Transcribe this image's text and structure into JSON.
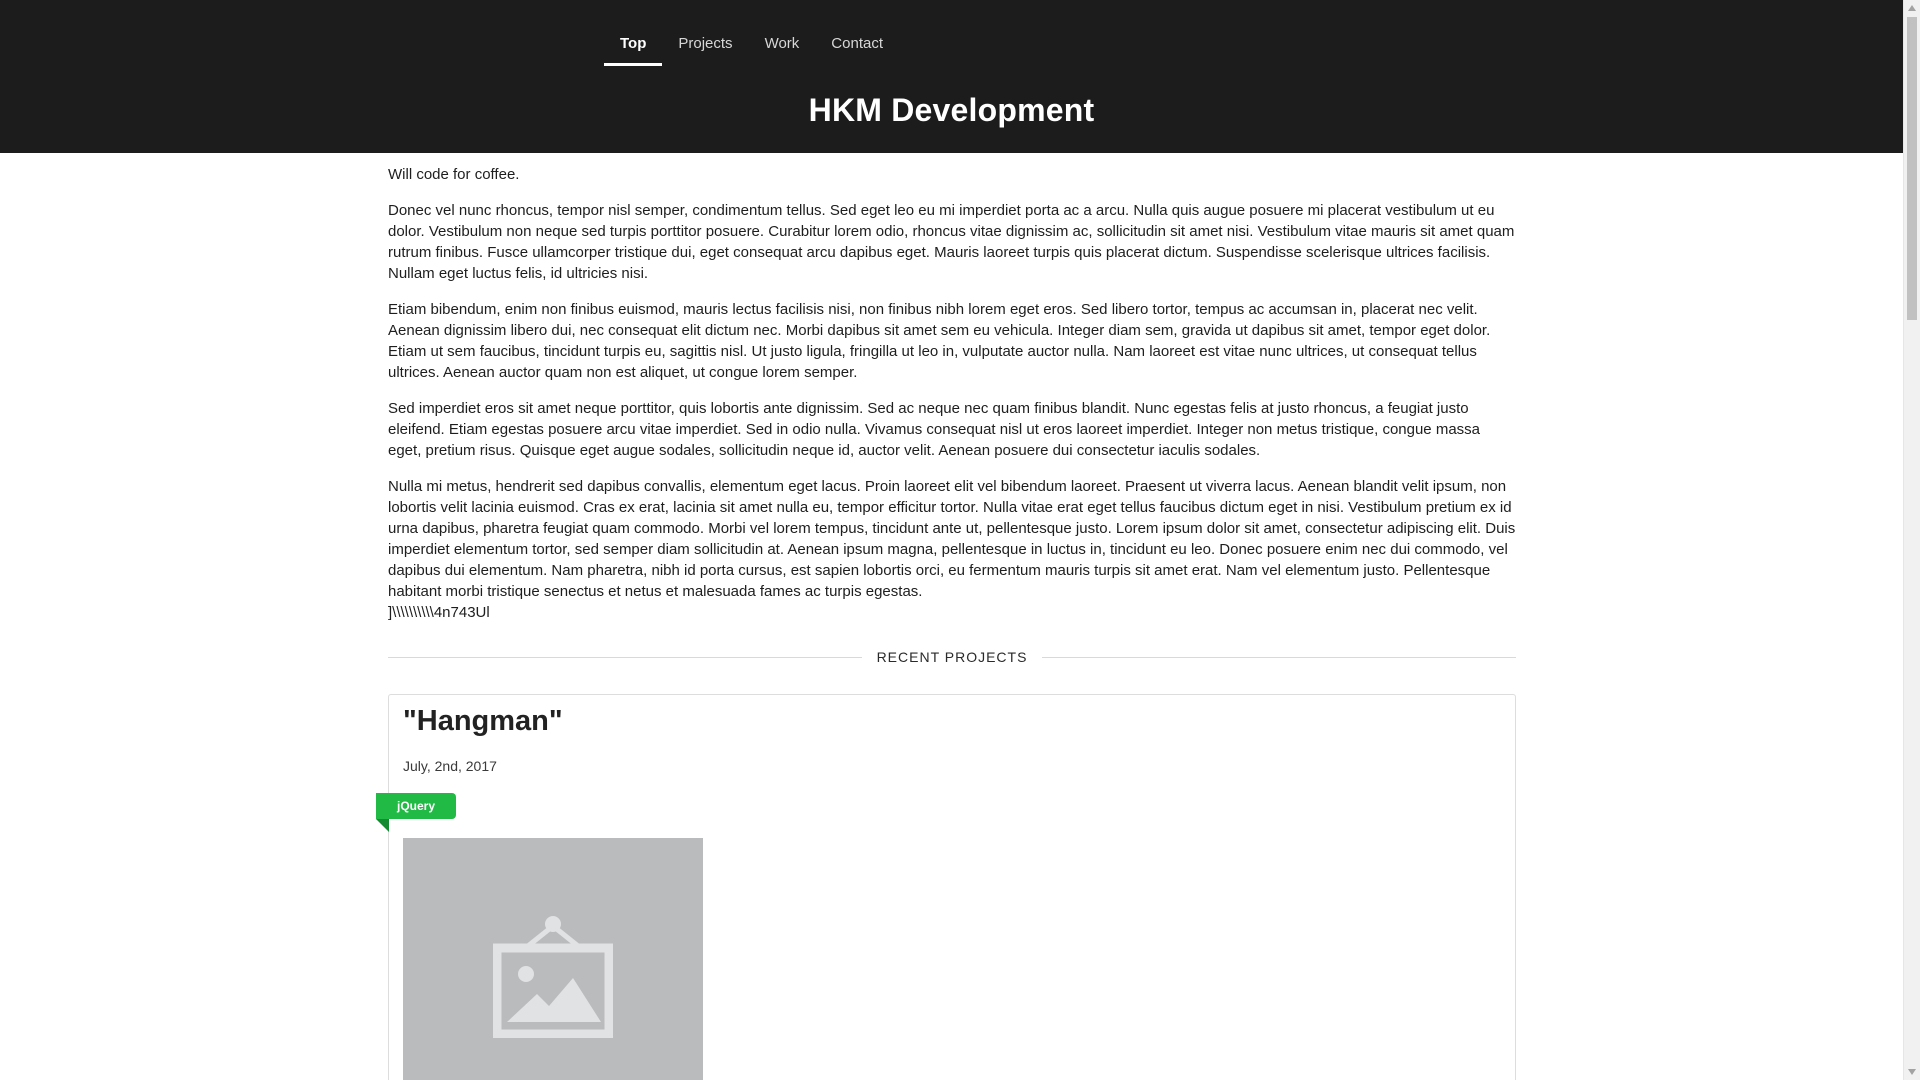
{
  "nav": {
    "items": [
      {
        "label": "Top",
        "active": true
      },
      {
        "label": "Projects",
        "active": false
      },
      {
        "label": "Work",
        "active": false
      },
      {
        "label": "Contact",
        "active": false
      }
    ]
  },
  "header": {
    "title": "HKM Development"
  },
  "main": {
    "tagline": "Will code for coffee.",
    "paragraphs": [
      "Donec vel nunc rhoncus, tempor nisl semper, condimentum tellus. Sed eget leo eu mi imperdiet porta ac a arcu. Nulla quis augue posuere mi placerat vestibulum ut eu dolor. Vestibulum non neque sed turpis porttitor posuere. Curabitur lorem odio, rhoncus vitae dignissim ac, sollicitudin sit amet nisi. Vestibulum vitae mauris sit amet quam rutrum finibus. Fusce ullamcorper tristique dui, eget consequat arcu dapibus eget. Mauris laoreet turpis quis placerat dictum. Suspendisse scelerisque ultrices facilisis. Nullam eget luctus felis, id ultricies nisi.",
      "Etiam bibendum, enim non finibus euismod, mauris lectus facilisis nisi, non finibus nibh lorem eget eros. Sed libero tortor, tempus ac accumsan in, placerat nec velit. Aenean dignissim libero dui, nec consequat elit dictum nec. Morbi dapibus sit amet sem eu vehicula. Integer diam sem, gravida ut dapibus sit amet, tempor eget dolor. Etiam ut sem faucibus, tincidunt turpis eu, sagittis nisl. Ut justo ligula, fringilla ut leo in, vulputate auctor nulla. Nam laoreet est vitae nunc ultrices, ut consequat tellus ultrices. Aenean auctor quam non est aliquet, ut congue lorem semper.",
      "Sed imperdiet eros sit amet neque porttitor, quis lobortis ante dignissim. Sed ac neque nec quam finibus blandit. Nunc egestas felis at justo rhoncus, a feugiat justo eleifend. Etiam egestas posuere arcu vitae imperdiet. Sed in odio nulla. Vivamus consequat nisl ut eros laoreet imperdiet. Integer non metus tristique, congue massa eget, pretium risus. Quisque eget augue sodales, sollicitudin neque id, auctor velit. Aenean posuere dui consectetur iaculis sodales.",
      "Nulla mi metus, hendrerit sed dapibus convallis, elementum eget lacus. Proin laoreet elit vel bibendum laoreet. Praesent ut viverra lacus. Aenean blandit velit ipsum, non lobortis velit lacinia euismod. Cras ex erat, lacinia sit amet nulla eu, tempor efficitur tortor. Nulla vitae erat eget tellus faucibus dictum eget in nisi. Vestibulum pretium ex id urna dapibus, pharetra feugiat quam commodo. Morbi vel lorem tempus, tincidunt ante ut, pellentesque justo. Lorem ipsum dolor sit amet, consectetur adipiscing elit. Duis imperdiet elementum tortor, sed semper diam sollicitudin at. Aenean ipsum magna, pellentesque in luctus in, tincidunt eu leo. Donec posuere enim nec dui commodo, vel dapibus dui elementum. Nam pharetra, nibh id porta cursus, est sapien lobortis orci, eu fermentum mauris turpis sit amet erat. Nam vel elementum justo. Pellentesque habitant morbi tristique senectus et netus et malesuada fames ac turpis egestas."
    ],
    "paragraph_tail": "]\\\\\\\\\\\\\\\\\\\\4n743Ul"
  },
  "recent_projects": {
    "heading": "RECENT PROJECTS",
    "projects": [
      {
        "title": "\"Hangman\"",
        "date": "July, 2nd, 2017",
        "tag": "jQuery",
        "image_icon": "image-placeholder-icon"
      }
    ]
  },
  "colors": {
    "header_bg": "#1c1c1d",
    "tag_green": "#21ba45",
    "thumbnail_bg": "#babbbc"
  }
}
